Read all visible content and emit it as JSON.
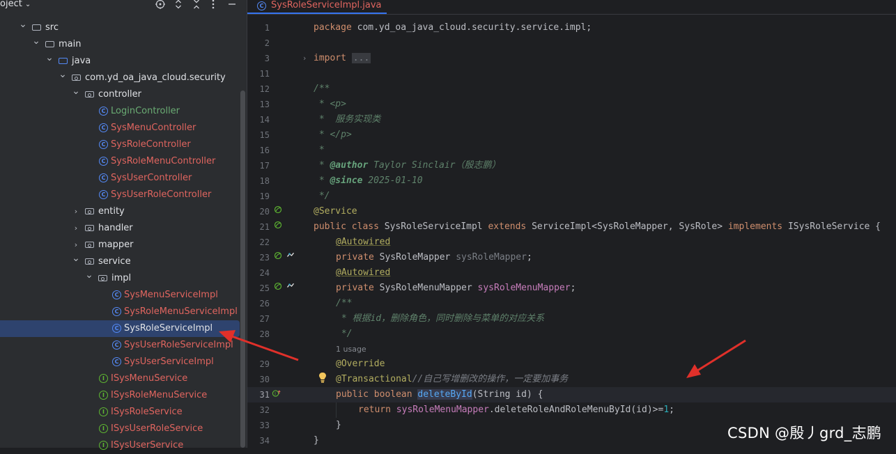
{
  "project_panel": {
    "title": "oject",
    "tree": [
      {
        "label": "src",
        "kind": "folder",
        "color": "white",
        "expanded": true
      },
      {
        "label": "main",
        "kind": "folder",
        "color": "white",
        "expanded": true
      },
      {
        "label": "java",
        "kind": "folder-blue",
        "color": "white",
        "expanded": true
      },
      {
        "label": "com.yd_oa_java_cloud.security",
        "kind": "package",
        "color": "white",
        "expanded": true
      },
      {
        "label": "controller",
        "kind": "package",
        "color": "white",
        "expanded": true
      },
      {
        "label": "LoginController",
        "kind": "class",
        "color": "green"
      },
      {
        "label": "SysMenuController",
        "kind": "class",
        "color": "red"
      },
      {
        "label": "SysRoleController",
        "kind": "class",
        "color": "red"
      },
      {
        "label": "SysRoleMenuController",
        "kind": "class",
        "color": "red"
      },
      {
        "label": "SysUserController",
        "kind": "class",
        "color": "red"
      },
      {
        "label": "SysUserRoleController",
        "kind": "class",
        "color": "red"
      },
      {
        "label": "entity",
        "kind": "package",
        "color": "white",
        "expanded": false
      },
      {
        "label": "handler",
        "kind": "package",
        "color": "white",
        "expanded": false
      },
      {
        "label": "mapper",
        "kind": "package",
        "color": "white",
        "expanded": false
      },
      {
        "label": "service",
        "kind": "package",
        "color": "white",
        "expanded": true
      },
      {
        "label": "impl",
        "kind": "package",
        "color": "white",
        "expanded": true
      },
      {
        "label": "SysMenuServiceImpl",
        "kind": "class",
        "color": "red"
      },
      {
        "label": "SysRoleMenuServiceImpl",
        "kind": "class",
        "color": "red"
      },
      {
        "label": "SysRoleServiceImpl",
        "kind": "class",
        "color": "white",
        "selected": true
      },
      {
        "label": "SysUserRoleServiceImpl",
        "kind": "class",
        "color": "red"
      },
      {
        "label": "SysUserServiceImpl",
        "kind": "class",
        "color": "red"
      },
      {
        "label": "ISysMenuService",
        "kind": "interface",
        "color": "red"
      },
      {
        "label": "ISysRoleMenuService",
        "kind": "interface",
        "color": "red"
      },
      {
        "label": "ISysRoleService",
        "kind": "interface",
        "color": "red"
      },
      {
        "label": "ISysUserRoleService",
        "kind": "interface",
        "color": "red"
      },
      {
        "label": "ISysUserService",
        "kind": "interface",
        "color": "red"
      }
    ]
  },
  "editor": {
    "tab_label": "SysRoleServiceImpl.java",
    "line_numbers": [
      "1",
      "2",
      "3",
      "11",
      "12",
      "13",
      "14",
      "15",
      "16",
      "17",
      "18",
      "19",
      "20",
      "21",
      "22",
      "23",
      "24",
      "25",
      "26",
      "27",
      "28",
      "",
      "29",
      "30",
      "31",
      "32",
      "33",
      "34"
    ],
    "current_line": "31",
    "usage_hint": "1 usage",
    "lines": {
      "l1_kw": "package",
      "l1_rest": " com.yd_oa_java_cloud.security.service.impl;",
      "l3_kw": "import",
      "l3_fold": "...",
      "l12": "/**",
      "l13_star": " * ",
      "l13_tag": "<p>",
      "l14": " *  服务实现类",
      "l15_star": " * ",
      "l15_tag": "</p>",
      "l16": " *",
      "l17_star": " * ",
      "l17_at": "@author",
      "l17_rest": " Taylor Sinclair（殷志鹏）",
      "l18_star": " * ",
      "l18_at": "@since",
      "l18_rest": " 2025-01-10",
      "l19": " */",
      "l20": "@Service",
      "l21_kw1": "public class ",
      "l21_name": "SysRoleServiceImpl ",
      "l21_kw2": "extends ",
      "l21_mid": "ServiceImpl<SysRoleMapper, SysRole> ",
      "l21_kw3": "implements ",
      "l21_end": "ISysRoleService {",
      "l22": "@Autowired",
      "l23_kw": "private ",
      "l23_type": "SysRoleMapper ",
      "l23_field": "sysRoleMapper",
      "l23_end": ";",
      "l24": "@Autowired",
      "l25_kw": "private ",
      "l25_type": "SysRoleMenuMapper ",
      "l25_field": "sysRoleMenuMapper",
      "l25_end": ";",
      "l26": "/**",
      "l27": " * 根据id，删除角色，同时删除与菜单的对应关系",
      "l28": " */",
      "l29": "@Override",
      "l30_ann": "@Transactional",
      "l30_cmt": "//自己写增删改的操作，一定要加事务",
      "l31_kw": "public boolean ",
      "l31_method": "deleteById",
      "l31_rest": "(String id) {",
      "l32_kw": "return ",
      "l32_field": "sysRoleMenuMapper",
      "l32_rest": ".deleteRoleAndRoleMenuById(id)>=",
      "l32_num": "1",
      "l32_end": ";",
      "l33": "}",
      "l34": "}"
    }
  },
  "watermark": "CSDN @殷丿grd_志鹏",
  "colors": {
    "accent": "#3574f0",
    "annotation_arrow": "#e0302a",
    "vcs_new_file": "#e0655f",
    "vcs_unchanged": "#6aab73"
  }
}
